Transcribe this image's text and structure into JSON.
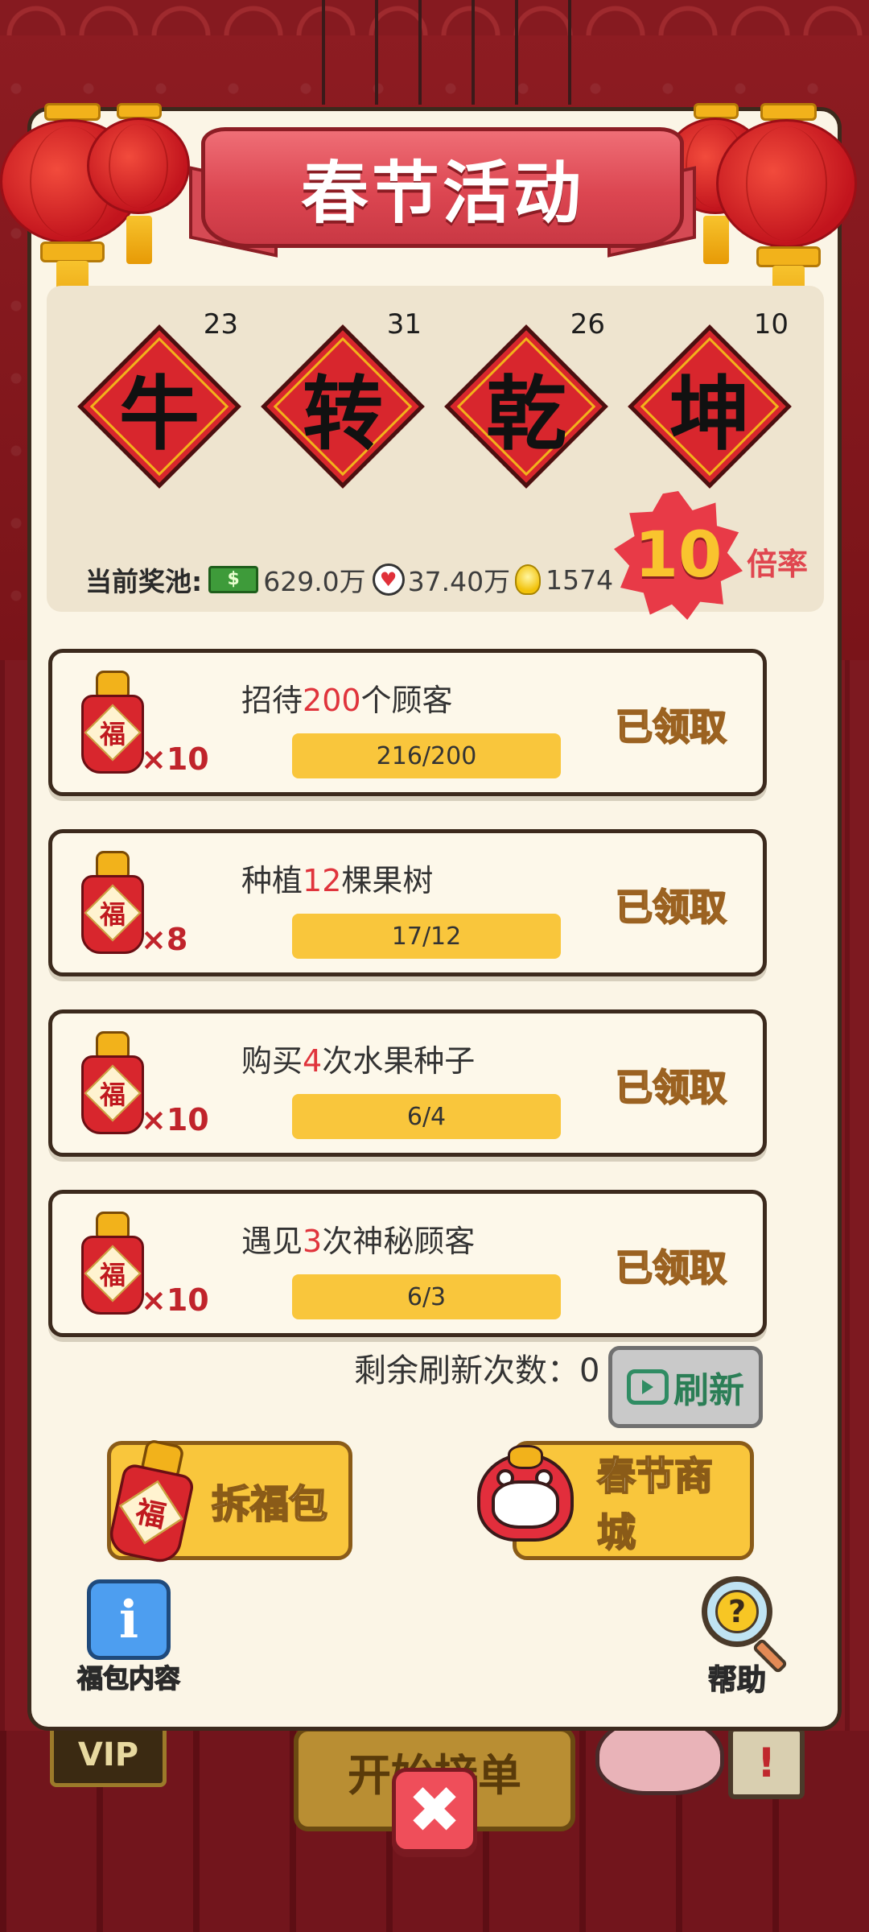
{
  "title": "春节活动",
  "characters": [
    {
      "char": "牛",
      "count": "23"
    },
    {
      "char": "转",
      "count": "31"
    },
    {
      "char": "乾",
      "count": "26"
    },
    {
      "char": "坤",
      "count": "10"
    }
  ],
  "pool": {
    "label": "当前奖池:",
    "money_icon": "$",
    "money": "629.0万",
    "hearts": "37.40万",
    "bulbs": "1574"
  },
  "multiplier": {
    "value": "10",
    "label": "倍率"
  },
  "tasks": [
    {
      "pre": "招待",
      "num": "200",
      "post": "个顾客",
      "reward": "×10",
      "progress": "216/200",
      "status": "已领取"
    },
    {
      "pre": "种植",
      "num": "12",
      "post": "棵果树",
      "reward": "×8",
      "progress": "17/12",
      "status": "已领取"
    },
    {
      "pre": "购买",
      "num": "4",
      "post": "次水果种子",
      "reward": "×10",
      "progress": "6/4",
      "status": "已领取"
    },
    {
      "pre": "遇见",
      "num": "3",
      "post": "次神秘顾客",
      "reward": "×10",
      "progress": "6/3",
      "status": "已领取"
    }
  ],
  "fu_char": "福",
  "refresh": {
    "remaining_label": "剩余刷新次数：0",
    "button": "刷新"
  },
  "buttons": {
    "open_fubao": "拆福包",
    "spring_shop": "春节商城"
  },
  "info": {
    "icon": "i",
    "label": "福包内容"
  },
  "help": {
    "icon": "?",
    "label": "帮助"
  },
  "close": "✖",
  "background": {
    "vip": "VIP",
    "start_orders": "开始接单",
    "note": "!"
  }
}
